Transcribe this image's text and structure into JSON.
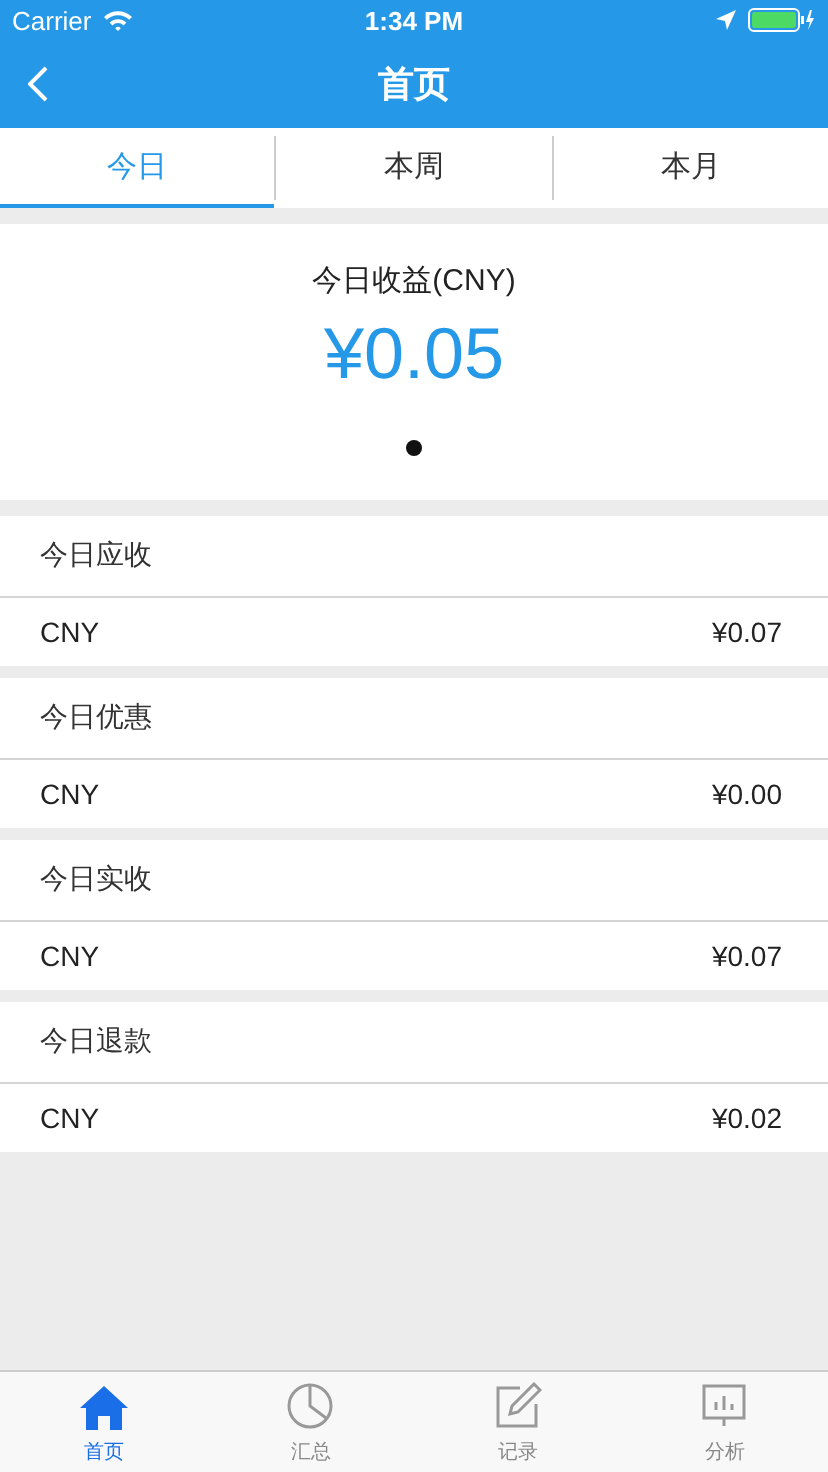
{
  "status_bar": {
    "carrier": "Carrier",
    "time": "1:34 PM"
  },
  "nav": {
    "title": "首页"
  },
  "tabs": [
    {
      "label": "今日",
      "selected": true
    },
    {
      "label": "本周",
      "selected": false
    },
    {
      "label": "本月",
      "selected": false
    }
  ],
  "summary": {
    "title": "今日收益(CNY)",
    "amount": "¥0.05"
  },
  "groups": [
    {
      "title": "今日应收",
      "currency": "CNY",
      "value": "¥0.07"
    },
    {
      "title": "今日优惠",
      "currency": "CNY",
      "value": "¥0.00"
    },
    {
      "title": "今日实收",
      "currency": "CNY",
      "value": "¥0.07"
    },
    {
      "title": "今日退款",
      "currency": "CNY",
      "value": "¥0.02"
    }
  ],
  "tab_bar": [
    {
      "label": "首页",
      "selected": true
    },
    {
      "label": "汇总",
      "selected": false
    },
    {
      "label": "记录",
      "selected": false
    },
    {
      "label": "分析",
      "selected": false
    }
  ]
}
